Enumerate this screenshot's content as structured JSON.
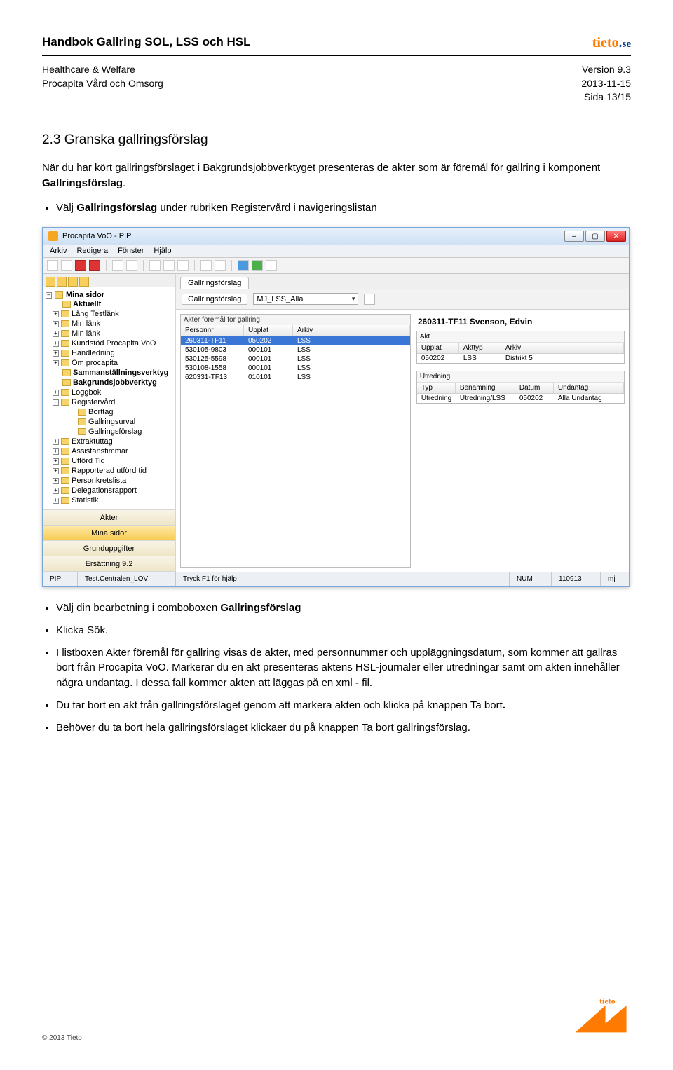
{
  "header": {
    "doc_title": "Handbok Gallring SOL, LSS och HSL",
    "sub_left_1": "Healthcare & Welfare",
    "sub_left_2": "Procapita Vård och Omsorg",
    "sub_right_1": "Version 9.3",
    "sub_right_2": "2013-11-15",
    "sub_right_3": "Sida 13/15",
    "logo_text": "tieto",
    "logo_dot": ".",
    "logo_se": "se"
  },
  "section": {
    "title": "2.3 Granska gallringsförslag",
    "intro_a": "När du har kört gallringsförslaget i Bakgrundsjobbverktyget presenteras de akter som är föremål för gallring i komponent ",
    "intro_b": "Gallringsförslag",
    "intro_c": ".",
    "bullet1_a": "Välj ",
    "bullet1_b": "Gallringsförslag",
    "bullet1_c": " under rubriken Registervård i navigeringslistan"
  },
  "after": {
    "b1_a": "Välj din bearbetning i comboboxen ",
    "b1_b": "Gallringsförslag",
    "b2": "Klicka Sök.",
    "b3": "I listboxen Akter föremål för gallring visas de akter, med personnummer och uppläggningsdatum, som kommer att gallras bort från Procapita VoO. Markerar du en akt presenteras aktens HSL-journaler eller utredningar samt om akten innehåller några undantag. I dessa fall kommer akten att läggas på en xml - fil.",
    "b4_a": "Du tar bort en akt från gallringsförslaget genom att markera akten och klicka på knappen Ta bort",
    "b4_b": ".",
    "b5": "Behöver du ta bort hela gallringsförslaget klickaer du på knappen Ta bort gallringsförslag."
  },
  "app": {
    "title": "Procapita VoO - PIP",
    "menus": [
      "Arkiv",
      "Redigera",
      "Fönster",
      "Hjälp"
    ],
    "leftnav_top": "Mina sidor",
    "tree": [
      {
        "tw": "",
        "bold": true,
        "label": "Aktuellt"
      },
      {
        "tw": "+",
        "label": "Lång Testlänk"
      },
      {
        "tw": "+",
        "label": "Min länk"
      },
      {
        "tw": "+",
        "label": "Min länk"
      },
      {
        "tw": "+",
        "label": "Kundstöd Procapita VoO"
      },
      {
        "tw": "+",
        "label": "Handledning"
      },
      {
        "tw": "+",
        "label": "Om procapita"
      },
      {
        "tw": "",
        "bold": true,
        "label": "Sammanställningsverktyg"
      },
      {
        "tw": "",
        "bold": true,
        "label": "Bakgrundsjobbverktyg"
      },
      {
        "tw": "+",
        "label": "Loggbok"
      },
      {
        "tw": "-",
        "label": "Registervård"
      },
      {
        "tw": "",
        "indent": true,
        "label": "Borttag"
      },
      {
        "tw": "",
        "indent": true,
        "label": "Gallringsurval"
      },
      {
        "tw": "",
        "indent": true,
        "label": "Gallringsförslag"
      },
      {
        "tw": "+",
        "label": "Extraktuttag"
      },
      {
        "tw": "+",
        "label": "Assistanstimmar"
      },
      {
        "tw": "+",
        "label": "Utförd Tid"
      },
      {
        "tw": "+",
        "label": "Rapporterad utförd tid"
      },
      {
        "tw": "+",
        "label": "Personkretslista"
      },
      {
        "tw": "+",
        "label": "Delegationsrapport"
      },
      {
        "tw": "+",
        "label": "Statistik"
      }
    ],
    "nav_buttons": [
      "Akter",
      "Mina sidor",
      "Grunduppgifter",
      "Ersättning 9.2"
    ],
    "nav_selected_index": 1,
    "tab_label": "Gallringsförslag",
    "subtab_label": "Gallringsförslag",
    "combo_value": "MJ_LSS_Alla",
    "group_label": "Akter föremål för gallring",
    "list_headers": [
      "Personnr",
      "Upplat",
      "Arkiv"
    ],
    "list_rows": [
      {
        "c": [
          "260311-TF11",
          "050202",
          "LSS"
        ],
        "sel": true
      },
      {
        "c": [
          "530105-9803",
          "000101",
          "LSS"
        ]
      },
      {
        "c": [
          "530125-5598",
          "000101",
          "LSS"
        ]
      },
      {
        "c": [
          "530108-1558",
          "000101",
          "LSS"
        ]
      },
      {
        "c": [
          "620331-TF13",
          "010101",
          "LSS"
        ]
      }
    ],
    "detail_title": "260311-TF11   Svenson, Edvin",
    "akt_panel_title": "Akt",
    "akt_headers": [
      "Upplat",
      "Akttyp",
      "Arkiv"
    ],
    "akt_row": [
      "050202",
      "LSS",
      "Distrikt 5"
    ],
    "utr_panel_title": "Utredning",
    "utr_headers": [
      "Typ",
      "Benämning",
      "Datum",
      "Undantag"
    ],
    "utr_row": [
      "Utredning",
      "Utredning/LSS",
      "050202",
      "Alla Undantag"
    ],
    "status": {
      "c1": "PIP",
      "c2": "Test.Centralen_LOV",
      "c3": "Tryck F1 för hjälp",
      "c4": "NUM",
      "c5": "110913",
      "c6": "mj"
    }
  },
  "footer": {
    "copyright": "© 2013 Tieto"
  }
}
